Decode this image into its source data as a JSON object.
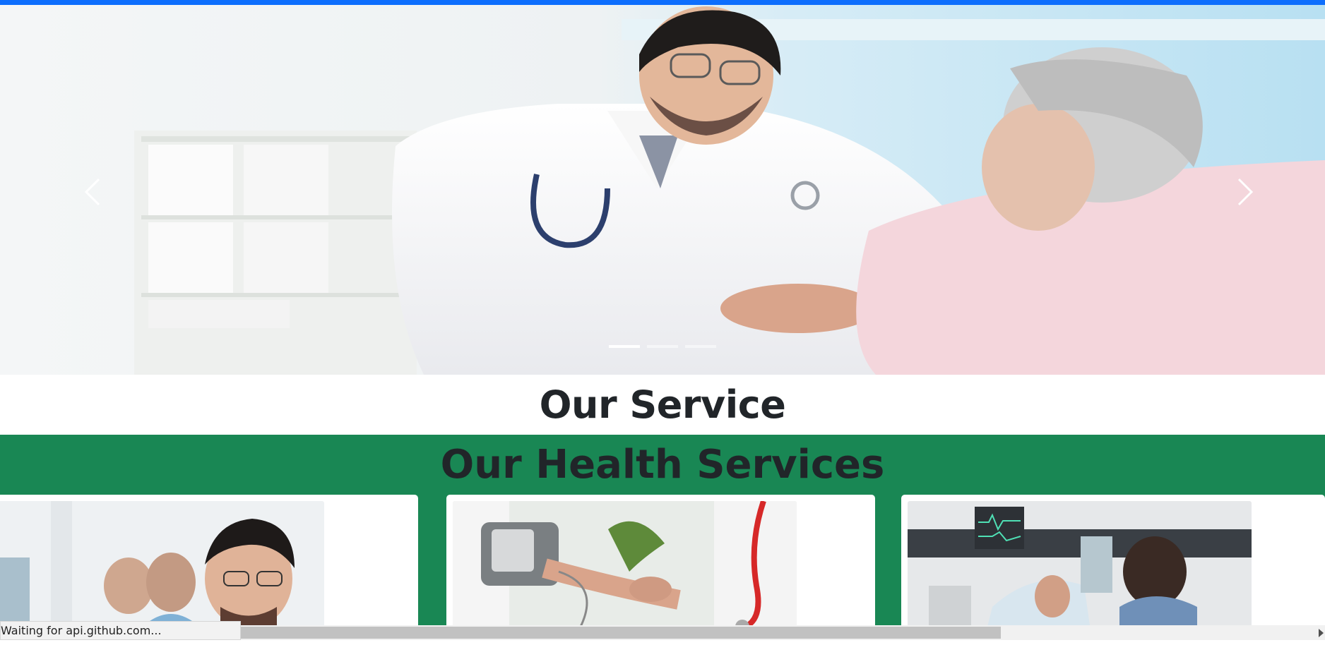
{
  "carousel": {
    "prev_icon": "chevron-left-icon",
    "next_icon": "chevron-right-icon",
    "slide_count": 3,
    "active_index": 0,
    "image": "doctor-holding-patient-hands"
  },
  "service_section": {
    "title": "Our Service"
  },
  "health_section": {
    "title": "Our Health Services",
    "background": "#198754",
    "cards": [
      {
        "image": "smiling-doctor-with-xray"
      },
      {
        "image": "blood-pressure-measurement"
      },
      {
        "image": "patient-in-hospital-bed-xray-review"
      }
    ]
  },
  "browser": {
    "accent": "#0d6efd",
    "status_text": "Waiting for api.github.com..."
  }
}
